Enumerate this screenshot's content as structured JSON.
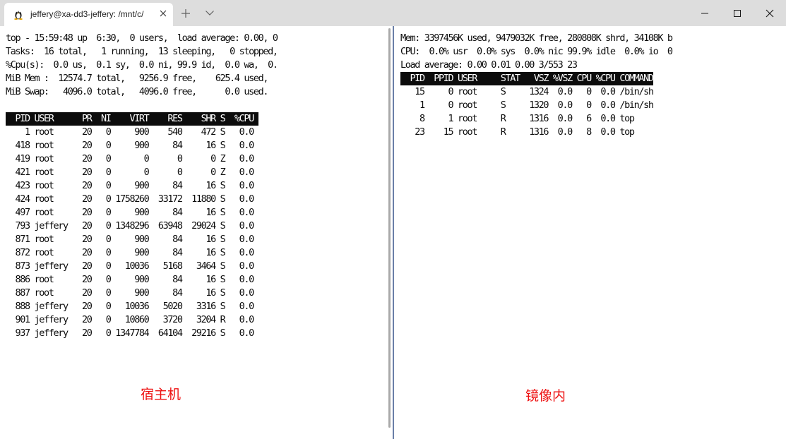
{
  "tab": {
    "title": "jeffery@xa-dd3-jeffery: /mnt/c/",
    "icon": "linux-tux-icon"
  },
  "colors": {
    "terminal_bg": "#ffffff",
    "terminal_fg": "#0c0c0c",
    "header_bg": "#0c0c0c",
    "header_fg": "#ffffff",
    "caption": "#ee1111",
    "divider": "#6a7fa8"
  },
  "host": {
    "summary": [
      "top - 15:59:48 up  6:30,  0 users,  load average: 0.00, 0",
      "Tasks:  16 total,   1 running,  13 sleeping,   0 stopped,",
      "%Cpu(s):  0.0 us,  0.1 sy,  0.0 ni, 99.9 id,  0.0 wa,  0.",
      "MiB Mem :  12574.7 total,   9256.9 free,    625.4 used,",
      "MiB Swap:   4096.0 total,   4096.0 free,      0.0 used."
    ],
    "header": "  PID USER      PR  NI    VIRT    RES    SHR S  %CPU ",
    "rows": [
      "    1 root      20   0     900    540    472 S   0.0",
      "  418 root      20   0     900     84     16 S   0.0",
      "  419 root      20   0       0      0      0 Z   0.0",
      "  421 root      20   0       0      0      0 Z   0.0",
      "  423 root      20   0     900     84     16 S   0.0",
      "  424 root      20   0 1758260  33172  11880 S   0.0",
      "  497 root      20   0     900     84     16 S   0.0",
      "  793 jeffery   20   0 1348296  63948  29024 S   0.0",
      "  871 root      20   0     900     84     16 S   0.0",
      "  872 root      20   0     900     84     16 S   0.0",
      "  873 jeffery   20   0   10036   5168   3464 S   0.0",
      "  886 root      20   0     900     84     16 S   0.0",
      "  887 root      20   0     900     84     16 S   0.0",
      "  888 jeffery   20   0   10036   5020   3316 S   0.0",
      "  901 jeffery   20   0   10860   3720   3204 R   0.0",
      "  937 jeffery   20   0 1347784  64104  29216 S   0.0"
    ],
    "caption": "宿主机"
  },
  "container": {
    "summary": [
      "Mem: 3397456K used, 9479032K free, 280808K shrd, 34108K b",
      "CPU:  0.0% usr  0.0% sys  0.0% nic 99.9% idle  0.0% io  0",
      "Load average: 0.00 0.01 0.00 3/553 23"
    ],
    "header": "  PID  PPID USER     STAT   VSZ %VSZ CPU %CPU COMMAND",
    "rows": [
      "   15     0 root     S     1324  0.0   0  0.0 /bin/sh",
      "    1     0 root     S     1320  0.0   0  0.0 /bin/sh",
      "    8     1 root     R     1316  0.0   6  0.0 top",
      "   23    15 root     R     1316  0.0   8  0.0 top"
    ],
    "caption": "镜像内"
  }
}
